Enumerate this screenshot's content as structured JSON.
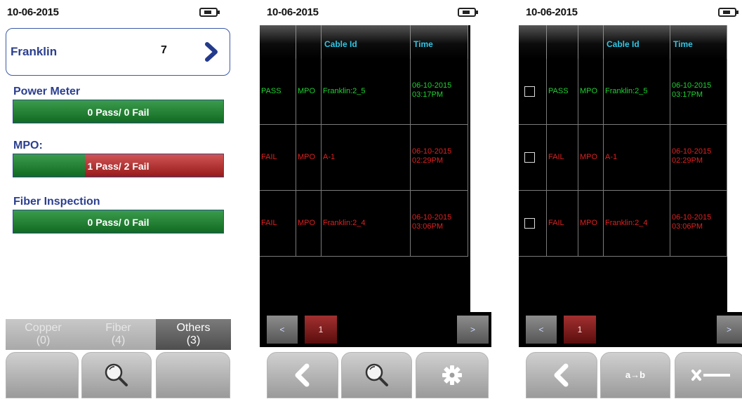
{
  "screen1": {
    "date": "10-06-2015",
    "project": {
      "name": "Franklin",
      "count": "7"
    },
    "sections": [
      {
        "label": "Power Meter",
        "summary": "0 Pass/ 0 Fail",
        "fail_fraction": 0
      },
      {
        "label": "MPO:",
        "summary": "1 Pass/ 2 Fail",
        "fail_fraction": 0.66
      },
      {
        "label": "Fiber Inspection",
        "summary": "0 Pass/ 0 Fail",
        "fail_fraction": 0
      }
    ],
    "tabs": [
      {
        "label": "Copper",
        "count": "(0)"
      },
      {
        "label": "Fiber",
        "count": "(4)"
      },
      {
        "label": "Others",
        "count": "(3)"
      }
    ],
    "buttons": [
      "blank",
      "search-icon",
      "blank"
    ]
  },
  "screen2": {
    "date": "10-06-2015",
    "headers": [
      "",
      "",
      "Cable Id",
      "Time"
    ],
    "rows": [
      {
        "status": "PASS",
        "type": "MPO",
        "cable": "Franklin:2_5",
        "time": "06-10-2015\n03:17PM"
      },
      {
        "status": "FAIL",
        "type": "MPO",
        "cable": "A-1",
        "time": "06-10-2015\n02:29PM"
      },
      {
        "status": "FAIL",
        "type": "MPO",
        "cable": "Franklin:2_4",
        "time": "06-10-2015\n03:06PM"
      }
    ],
    "pager": {
      "prev": "<",
      "page": "1",
      "next": ">"
    },
    "buttons": [
      "back-icon",
      "search-icon",
      "gear-icon"
    ]
  },
  "screen3": {
    "date": "10-06-2015",
    "headers": [
      "",
      "",
      "",
      "Cable Id",
      "Time"
    ],
    "rows": [
      {
        "status": "PASS",
        "type": "MPO",
        "cable": "Franklin:2_5",
        "time": "06-10-2015\n03:17PM"
      },
      {
        "status": "FAIL",
        "type": "MPO",
        "cable": "A-1",
        "time": "06-10-2015\n02:29PM"
      },
      {
        "status": "FAIL",
        "type": "MPO",
        "cable": "Franklin:2_4",
        "time": "06-10-2015\n03:06PM"
      }
    ],
    "pager": {
      "prev": "<",
      "page": "1",
      "next": ">"
    },
    "buttons": [
      "back-icon",
      "rename-icon",
      "delete-icon"
    ],
    "rename_label": "a→b"
  },
  "colors": {
    "pass": "#1ed232",
    "fail": "#e02020",
    "header_text": "#2fc7e6",
    "title_blue": "#2b3f8f"
  }
}
